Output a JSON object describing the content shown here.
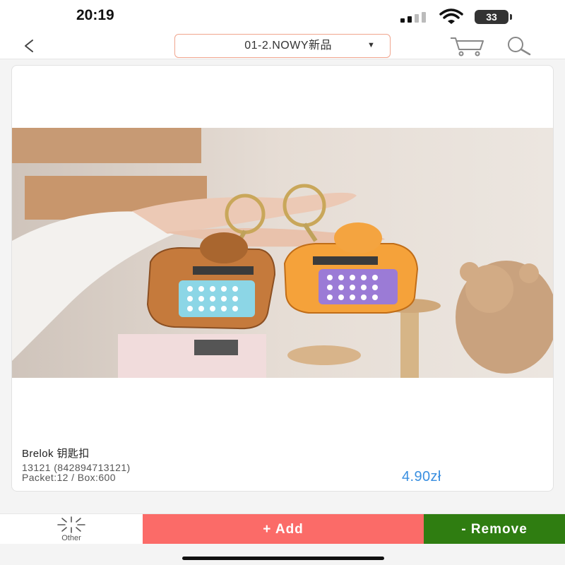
{
  "status_bar": {
    "time": "20:19",
    "battery": "33"
  },
  "nav": {
    "category": "01-2.NOWY新品",
    "icons": [
      "chevron-left-icon",
      "cart-icon",
      "search-icon",
      "caret-down-icon"
    ]
  },
  "product": {
    "name": "Brelok 钥匙扣",
    "code": "13121 (842894713121)",
    "packaging": "Packet:12 / Box:600",
    "price": "4.90zł",
    "image_description_colors": {
      "left_keychain": "#c57a3c",
      "right_keychain": "#f5a23a",
      "price_color": "#3a8fe0"
    }
  },
  "actions": {
    "other_label": "Other",
    "add_label": "+ Add",
    "remove_label": "- Remove",
    "add_color": "#fb6b68",
    "remove_color": "#2f7d11"
  }
}
